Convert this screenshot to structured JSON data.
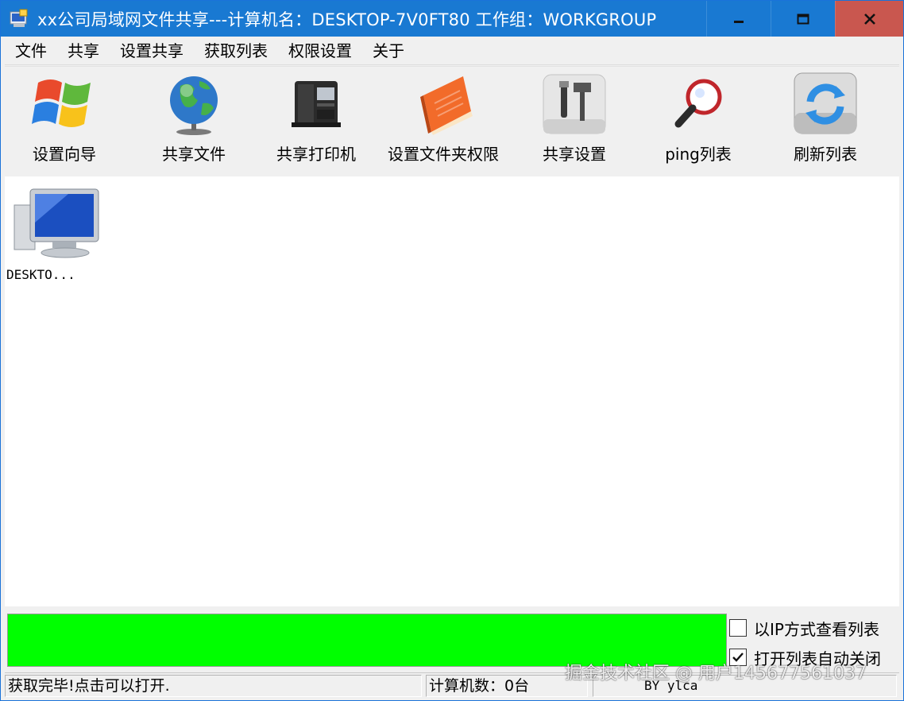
{
  "window": {
    "title": "xx公司局域网文件共享---计算机名：DESKTOP-7V0FT80  工作组：WORKGROUP",
    "min_icon": "minimize-icon",
    "max_icon": "maximize-icon",
    "close_icon": "close-icon"
  },
  "menu": [
    {
      "label": "文件"
    },
    {
      "label": "共享"
    },
    {
      "label": "设置共享"
    },
    {
      "label": "获取列表"
    },
    {
      "label": "权限设置"
    },
    {
      "label": "关于"
    }
  ],
  "toolbar": [
    {
      "label": "设置向导",
      "icon": "windows-logo-icon"
    },
    {
      "label": "共享文件",
      "icon": "globe-icon"
    },
    {
      "label": "共享打印机",
      "icon": "printer-icon"
    },
    {
      "label": "设置文件夹权限",
      "icon": "notebook-icon"
    },
    {
      "label": "共享设置",
      "icon": "tools-icon"
    },
    {
      "label": "ping列表",
      "icon": "magnifier-icon"
    },
    {
      "label": "刷新列表",
      "icon": "refresh-icon"
    }
  ],
  "computers": [
    {
      "label": "DESKTO...",
      "icon": "computer-icon"
    }
  ],
  "progress": {
    "value": 1.0,
    "color": "#00ff00"
  },
  "options": {
    "view_by_ip": {
      "label": "以IP方式查看列表",
      "checked": false
    },
    "auto_close": {
      "label": "打开列表自动关闭",
      "checked": true
    }
  },
  "status": {
    "message": "获取完毕!点击可以打开.",
    "count": "计算机数：0台",
    "author": "BY ylca"
  },
  "watermark": "掘金技术社区 @ 用户1456775610​37",
  "colors": {
    "titlebar": "#1979d2",
    "close": "#c9574f",
    "progress": "#00ff00"
  }
}
